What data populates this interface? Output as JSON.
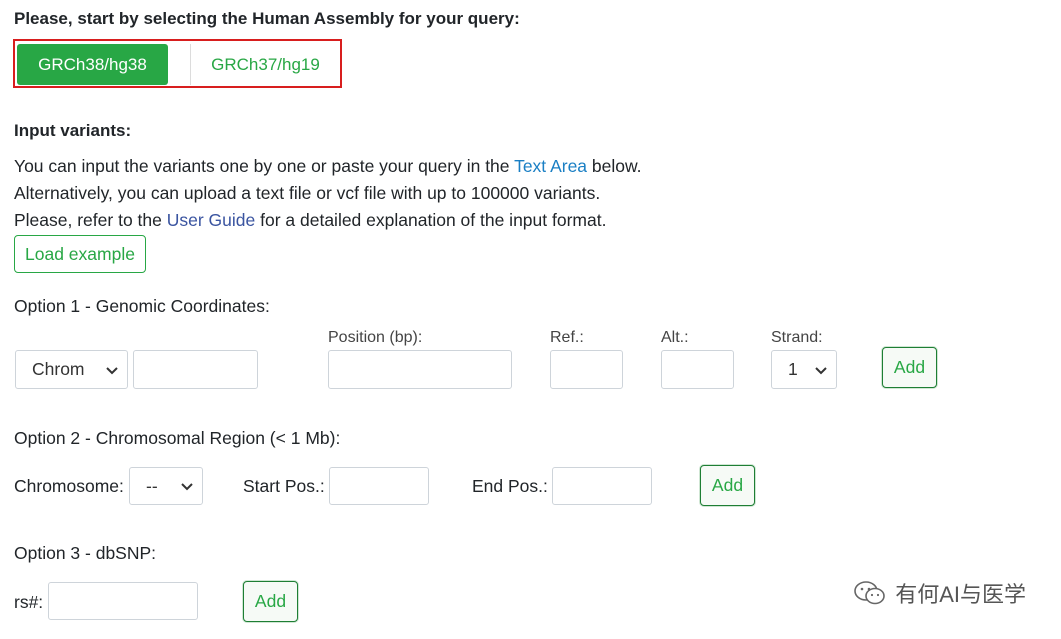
{
  "assembly": {
    "prompt": "Please, start by selecting the Human Assembly for your query:",
    "options": [
      "GRCh38/hg38",
      "GRCh37/hg19"
    ],
    "selected": "GRCh38/hg38"
  },
  "input": {
    "heading": "Input variants:",
    "line1_pre": "You can input the variants one by one or paste your query in the ",
    "line1_link": "Text Area",
    "line1_post": " below.",
    "line2": "Alternatively, you can upload a text file or vcf file with up to 100000 variants.",
    "line3_pre": "Please, refer to the ",
    "line3_link": "User Guide",
    "line3_post": " for a detailed explanation of the input format.",
    "load_example": "Load example"
  },
  "option1": {
    "title": "Option 1 - Genomic Coordinates:",
    "chrom_value": "Chrom",
    "position_label": "Position (bp):",
    "ref_label": "Ref.:",
    "alt_label": "Alt.:",
    "strand_label": "Strand:",
    "strand_value": "1",
    "add": "Add"
  },
  "option2": {
    "title": "Option 2 - Chromosomal Region (< 1 Mb):",
    "chromosome_label": "Chromosome:",
    "chromosome_value": "--",
    "start_label": "Start Pos.:",
    "end_label": "End Pos.:",
    "add": "Add"
  },
  "option3": {
    "title": "Option 3 - dbSNP:",
    "rs_label": "rs#:",
    "add": "Add"
  },
  "watermark": {
    "text": "有何AI与医学",
    "icon": "wechat-icon"
  },
  "colors": {
    "accent": "#28a745",
    "highlight_border": "#d81e1e",
    "link": "#1a7fc4"
  }
}
